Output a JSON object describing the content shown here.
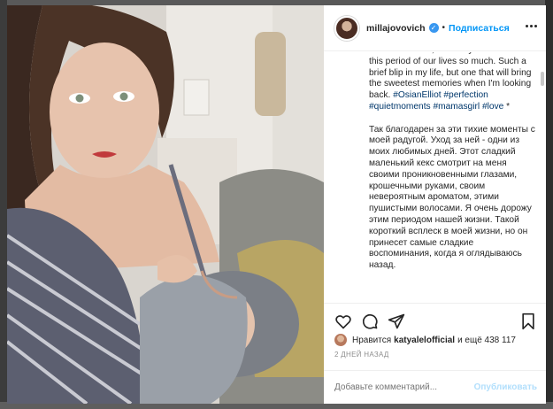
{
  "post": {
    "username": "millajovovich",
    "follow_label": "Подписаться",
    "separator": "•",
    "verified_symbol": "✓",
    "caption_en": "incredible scent, that fluffy hair. I treasure this period of our lives so much. Such a brief blip in my life, but one that will bring the sweetest memories when I'm looking back.",
    "hashtags": "#OsianElliot #perfection #quietmoments #mamasgirl #love",
    "caption_star": " *",
    "caption_ru": "Так благодарен за эти тихие моменты с моей радугой. Уход за ней - одни из моих любимых дней. Этот сладкий маленький кекс смотрит на меня своими проникновенными глазами, крошечными руками, своим невероятным ароматом, этими пушистыми волосами. Я очень дорожу этим периодом нашей жизни. Такой короткий всплеск в моей жизни, но он принесет самые сладкие воспоминания, когда я оглядываюсь назад.",
    "likes_prefix": "Нравится",
    "likes_user": "katyalelofficial",
    "likes_suffix": "и ещё 438 117",
    "date": "2 ДНЕЙ НАЗАД"
  },
  "comment": {
    "placeholder": "Добавьте комментарий...",
    "publish_label": "Опубликовать"
  },
  "icons": {
    "like": "heart-icon",
    "comment": "comment-icon",
    "share": "share-icon",
    "save": "bookmark-icon",
    "more": "more-icon"
  },
  "colors": {
    "link": "#0095f6",
    "hashtag": "#00376b",
    "text": "#262626",
    "muted": "#8e8e8e"
  }
}
